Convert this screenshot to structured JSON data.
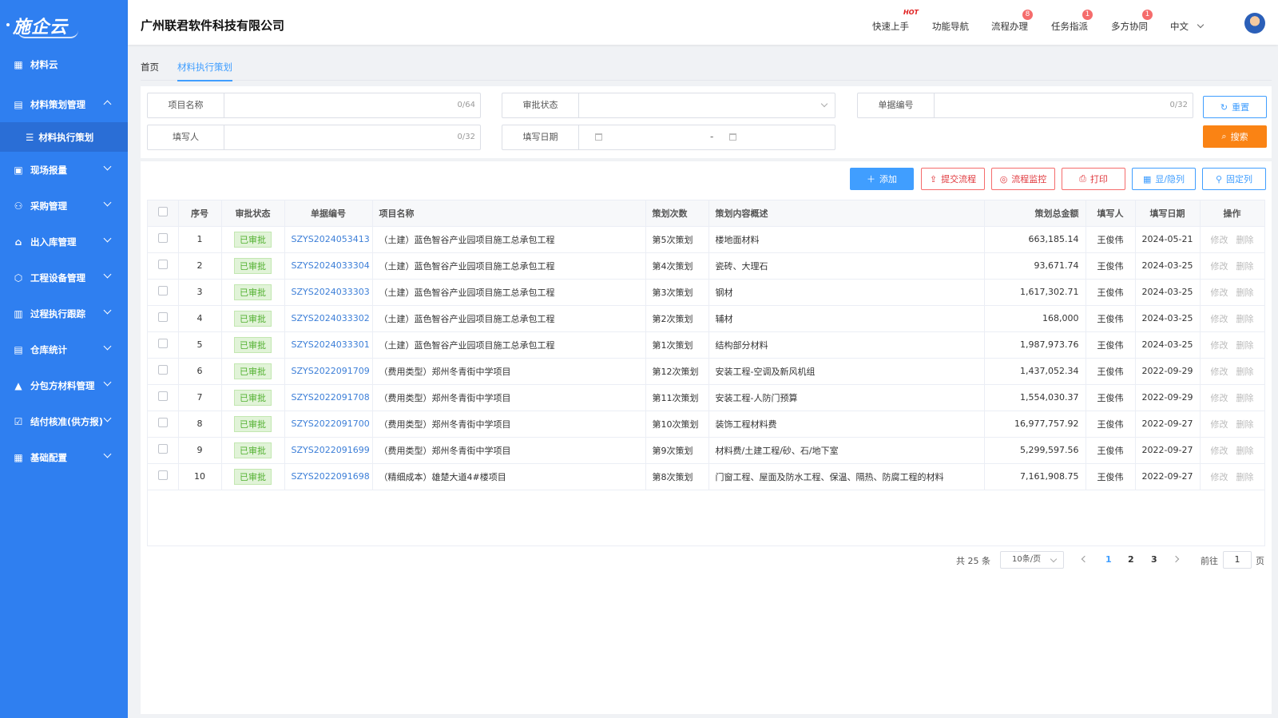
{
  "app": {
    "logo": "施企云",
    "company": "广州联君软件科技有限公司"
  },
  "header": {
    "nav": [
      {
        "label": "快速上手",
        "badge": "HOT"
      },
      {
        "label": "功能导航",
        "badge": ""
      },
      {
        "label": "流程办理",
        "badge": "8"
      },
      {
        "label": "任务指派",
        "badge": "1"
      },
      {
        "label": "多方协同",
        "badge": "1"
      }
    ],
    "lang": "中文"
  },
  "sidebar": {
    "items": [
      {
        "label": "材料云",
        "icon": "grid-icon"
      },
      {
        "label": "材料策划管理",
        "icon": "document-icon",
        "expanded": true
      },
      {
        "label": "材料执行策划",
        "icon": "list-icon",
        "sub": true
      },
      {
        "label": "现场报量",
        "icon": "report-icon"
      },
      {
        "label": "采购管理",
        "icon": "users-icon"
      },
      {
        "label": "出入库管理",
        "icon": "warehouse-icon"
      },
      {
        "label": "工程设备管理",
        "icon": "cube-icon"
      },
      {
        "label": "过程执行跟踪",
        "icon": "chart-icon"
      },
      {
        "label": "仓库统计",
        "icon": "stack-icon"
      },
      {
        "label": "分包方材料管理",
        "icon": "building-icon"
      },
      {
        "label": "结付核准(供方报)",
        "icon": "check-icon"
      },
      {
        "label": "基础配置",
        "icon": "apps-icon"
      }
    ]
  },
  "tabs": {
    "home": "首页",
    "current": "材料执行策划"
  },
  "filters": {
    "project_name": {
      "label": "项目名称",
      "count": "0/64"
    },
    "approval_status": {
      "label": "审批状态"
    },
    "doc_no": {
      "label": "单据编号",
      "count": "0/32"
    },
    "filler": {
      "label": "填写人",
      "count": "0/32"
    },
    "fill_date": {
      "label": "填写日期",
      "separator": "-"
    },
    "reset_label": "重置",
    "search_label": "搜索"
  },
  "toolbar": {
    "add": "添加",
    "submit": "提交流程",
    "monitor": "流程监控",
    "print": "打印",
    "toggle_cols": "显/隐列",
    "pin_cols": "固定列"
  },
  "table": {
    "headers": [
      "序号",
      "审批状态",
      "单据编号",
      "项目名称",
      "策划次数",
      "策划内容概述",
      "策划总金额",
      "填写人",
      "填写日期",
      "操作"
    ],
    "op_edit": "修改",
    "op_delete": "删除",
    "rows": [
      {
        "no": "1",
        "status": "已审批",
        "doc": "SZYS2024053413",
        "project": "（土建）蓝色智谷产业园项目施工总承包工程",
        "times": "第5次策划",
        "summary": "楼地面材料",
        "amount": "663,185.14",
        "filler": "王俊伟",
        "date": "2024-05-21"
      },
      {
        "no": "2",
        "status": "已审批",
        "doc": "SZYS2024033304",
        "project": "（土建）蓝色智谷产业园项目施工总承包工程",
        "times": "第4次策划",
        "summary": "瓷砖、大理石",
        "amount": "93,671.74",
        "filler": "王俊伟",
        "date": "2024-03-25"
      },
      {
        "no": "3",
        "status": "已审批",
        "doc": "SZYS2024033303",
        "project": "（土建）蓝色智谷产业园项目施工总承包工程",
        "times": "第3次策划",
        "summary": "钢材",
        "amount": "1,617,302.71",
        "filler": "王俊伟",
        "date": "2024-03-25"
      },
      {
        "no": "4",
        "status": "已审批",
        "doc": "SZYS2024033302",
        "project": "（土建）蓝色智谷产业园项目施工总承包工程",
        "times": "第2次策划",
        "summary": "辅材",
        "amount": "168,000",
        "filler": "王俊伟",
        "date": "2024-03-25"
      },
      {
        "no": "5",
        "status": "已审批",
        "doc": "SZYS2024033301",
        "project": "（土建）蓝色智谷产业园项目施工总承包工程",
        "times": "第1次策划",
        "summary": "结构部分材料",
        "amount": "1,987,973.76",
        "filler": "王俊伟",
        "date": "2024-03-25"
      },
      {
        "no": "6",
        "status": "已审批",
        "doc": "SZYS2022091709",
        "project": "（费用类型）郑州冬青街中学项目",
        "times": "第12次策划",
        "summary": "安装工程-空调及新风机组",
        "amount": "1,437,052.34",
        "filler": "王俊伟",
        "date": "2022-09-29"
      },
      {
        "no": "7",
        "status": "已审批",
        "doc": "SZYS2022091708",
        "project": "（费用类型）郑州冬青街中学项目",
        "times": "第11次策划",
        "summary": "安装工程-人防门预算",
        "amount": "1,554,030.37",
        "filler": "王俊伟",
        "date": "2022-09-29"
      },
      {
        "no": "8",
        "status": "已审批",
        "doc": "SZYS2022091700",
        "project": "（费用类型）郑州冬青街中学项目",
        "times": "第10次策划",
        "summary": "装饰工程材料费",
        "amount": "16,977,757.92",
        "filler": "王俊伟",
        "date": "2022-09-27"
      },
      {
        "no": "9",
        "status": "已审批",
        "doc": "SZYS2022091699",
        "project": "（费用类型）郑州冬青街中学项目",
        "times": "第9次策划",
        "summary": "材料费/土建工程/砂、石/地下室",
        "amount": "5,299,597.56",
        "filler": "王俊伟",
        "date": "2022-09-27"
      },
      {
        "no": "10",
        "status": "已审批",
        "doc": "SZYS2022091698",
        "project": "（精细成本）雄楚大道4#楼项目",
        "times": "第8次策划",
        "summary": "门窗工程、屋面及防水工程、保温、隔热、防腐工程的材料",
        "amount": "7,161,908.75",
        "filler": "王俊伟",
        "date": "2022-09-27"
      }
    ]
  },
  "pagination": {
    "total": "共 25 条",
    "page_size": "10条/页",
    "pages": [
      "1",
      "2",
      "3"
    ],
    "current": "1",
    "goto_label": "前往",
    "goto_value": "1",
    "page_unit": "页"
  },
  "colors": {
    "sidebar": "#2f7ff0",
    "primary": "#409eff",
    "search": "#fa8314",
    "danger": "#e0393e",
    "approved": "#52b130"
  }
}
